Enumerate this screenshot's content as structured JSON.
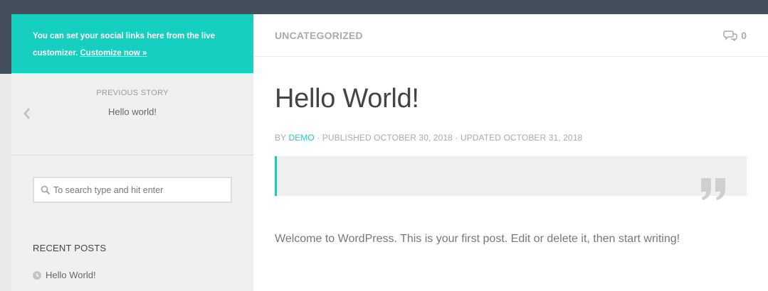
{
  "sidebar": {
    "social_notice": "You can set your social links here from the live customizer.",
    "customize_link": "Customize now »",
    "previous_story": {
      "label": "PREVIOUS STORY",
      "title": "Hello world!"
    },
    "search": {
      "placeholder": "To search type and hit enter"
    },
    "recent_posts": {
      "heading": "RECENT POSTS",
      "items": [
        {
          "title": "Hello World!"
        }
      ]
    }
  },
  "main": {
    "category": "UNCATEGORIZED",
    "comment_count": "0",
    "post": {
      "title": "Hello World!",
      "byline_prefix": "BY",
      "author": "DEMO",
      "published": "· PUBLISHED OCTOBER 30, 2018 · UPDATED OCTOBER 31, 2018",
      "body": "Welcome to WordPress. This is your first post. Edit or delete it, then start writing!"
    }
  },
  "colors": {
    "accent": "#16cfc1",
    "topbar": "#454e5c",
    "sidebar_bg": "#f0f0f0"
  },
  "icons": [
    "chevron-left-icon",
    "search-icon",
    "clock-icon",
    "comments-icon",
    "quote-icon"
  ]
}
